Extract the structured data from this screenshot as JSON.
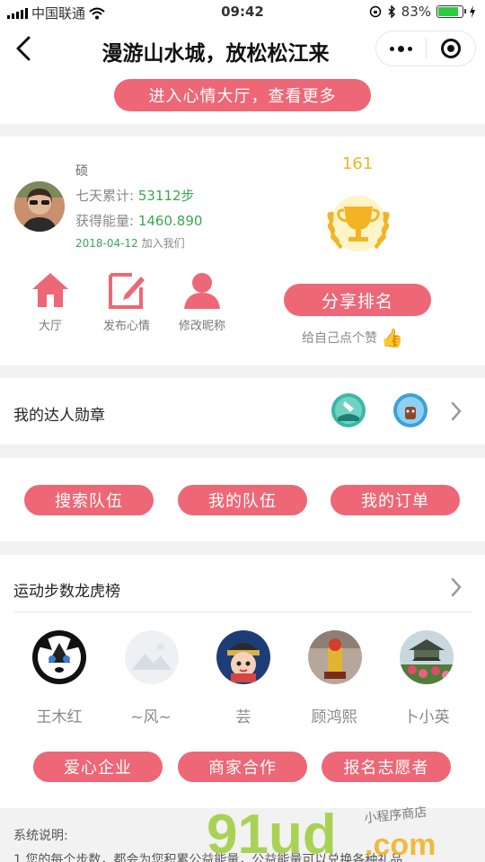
{
  "status_bar": {
    "carrier": "中国联通",
    "time": "09:42",
    "battery": "83%",
    "battery_level": 0.83
  },
  "navbar": {
    "title": "漫游山水城，放松松江来"
  },
  "hall_button": "进入心情大厅，查看更多",
  "profile": {
    "name": "硕",
    "week_total_label": "七天累计: ",
    "week_total_value": "53112步",
    "energy_label": "获得能量: ",
    "energy_value": "1460.890",
    "join_date": "2018-04-12",
    "join_suffix": " 加入我们",
    "score": "161",
    "share_button": "分享排名",
    "like_text": "给自己点个赞"
  },
  "actions": [
    {
      "label": "大厅",
      "icon": "home-icon"
    },
    {
      "label": "发布心情",
      "icon": "edit-icon"
    },
    {
      "label": "修改昵称",
      "icon": "user-icon"
    }
  ],
  "medals": {
    "title": "我的达人勋章"
  },
  "buttons_row1": [
    "搜索队伍",
    "我的队伍",
    "我的订单"
  ],
  "ranking": {
    "title": "运动步数龙虎榜",
    "users": [
      {
        "name": "王木红"
      },
      {
        "name": "~风~"
      },
      {
        "name": "芸"
      },
      {
        "name": "顾鸿熙"
      },
      {
        "name": "卜小英"
      }
    ]
  },
  "buttons_row2": [
    "爱心企业",
    "商家合作",
    "报名志愿者"
  ],
  "notes": {
    "title": "系统说明:",
    "line1": "1.您的每个步数，都会为您积累公益能量，公益能量可以兑换各种礼品"
  },
  "watermark": {
    "brand": "91ud",
    "domain": ".com",
    "tagline": "小程序商店"
  },
  "colors": {
    "accent": "#ed6776",
    "green": "#37a84f",
    "gold": "#f2b425"
  }
}
